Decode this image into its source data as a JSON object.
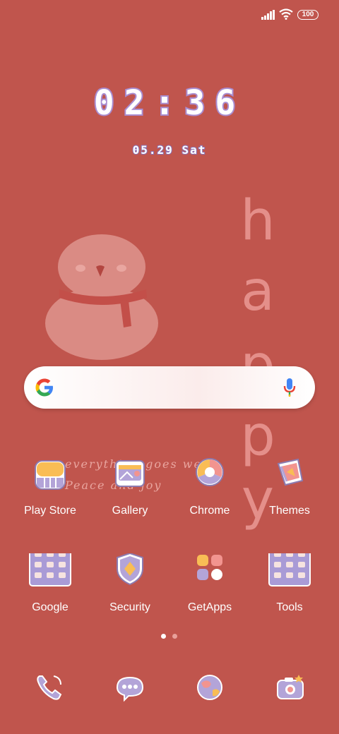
{
  "status_bar": {
    "battery_level": "100"
  },
  "clock": {
    "time": "02:36",
    "date": "05.29 Sat"
  },
  "wallpaper": {
    "letters": [
      "h",
      "a",
      "p",
      "p",
      "y"
    ],
    "line1": "everything goes well",
    "line2": "Peace and joy"
  },
  "home_rows": [
    [
      {
        "label": "Play Store",
        "icon": "play-store-icon"
      },
      {
        "label": "Gallery",
        "icon": "gallery-icon"
      },
      {
        "label": "Chrome",
        "icon": "chrome-icon"
      },
      {
        "label": "Themes",
        "icon": "themes-icon"
      }
    ],
    [
      {
        "label": "Google",
        "icon": "google-folder-icon"
      },
      {
        "label": "Security",
        "icon": "security-icon"
      },
      {
        "label": "GetApps",
        "icon": "getapps-icon"
      },
      {
        "label": "Tools",
        "icon": "tools-folder-icon"
      }
    ]
  ],
  "page_indicator": {
    "pages": 2,
    "current": 1
  },
  "dock": [
    "phone-icon",
    "messages-icon",
    "browser-icon",
    "camera-icon"
  ],
  "colors": {
    "background": "#c0554d",
    "accent_purple": "#a98dd1",
    "icon_bg": "#ffffff"
  }
}
